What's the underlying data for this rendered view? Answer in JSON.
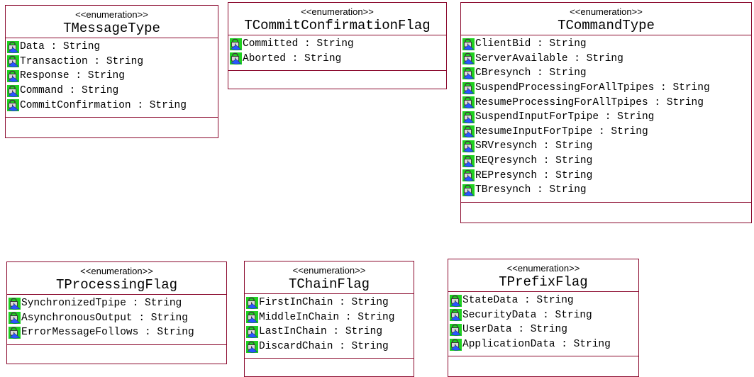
{
  "stereotype": "<<enumeration>>",
  "icon": "public-attribute-icon",
  "colors": {
    "border": "#8b0a2e",
    "icon_green": "#1fd11f",
    "icon_blue": "#2a55ff"
  },
  "classes": [
    {
      "name": "TMessageType",
      "attributes": [
        "Data : String",
        "Transaction : String",
        "Response : String",
        "Command : String",
        "CommitConfirmation : String"
      ]
    },
    {
      "name": "TCommitConfirmationFlag",
      "attributes": [
        "Committed : String",
        "Aborted : String"
      ]
    },
    {
      "name": "TCommandType",
      "attributes": [
        "ClientBid : String",
        "ServerAvailable : String",
        "CBresynch : String",
        "SuspendProcessingForAllTpipes : String",
        "ResumeProcessingForAllTpipes : String",
        "SuspendInputForTpipe : String",
        "ResumeInputForTpipe : String",
        "SRVresynch : String",
        "REQresynch : String",
        "REPresynch : String",
        "TBresynch : String"
      ]
    },
    {
      "name": "TProcessingFlag",
      "attributes": [
        "SynchronizedTpipe : String",
        "AsynchronousOutput : String",
        "ErrorMessageFollows : String"
      ]
    },
    {
      "name": "TChainFlag",
      "attributes": [
        "FirstInChain : String",
        "MiddleInChain : String",
        "LastInChain : String",
        "DiscardChain : String"
      ]
    },
    {
      "name": "TPrefixFlag",
      "attributes": [
        "StateData : String",
        "SecurityData : String",
        "UserData : String",
        "ApplicationData : String"
      ]
    }
  ]
}
